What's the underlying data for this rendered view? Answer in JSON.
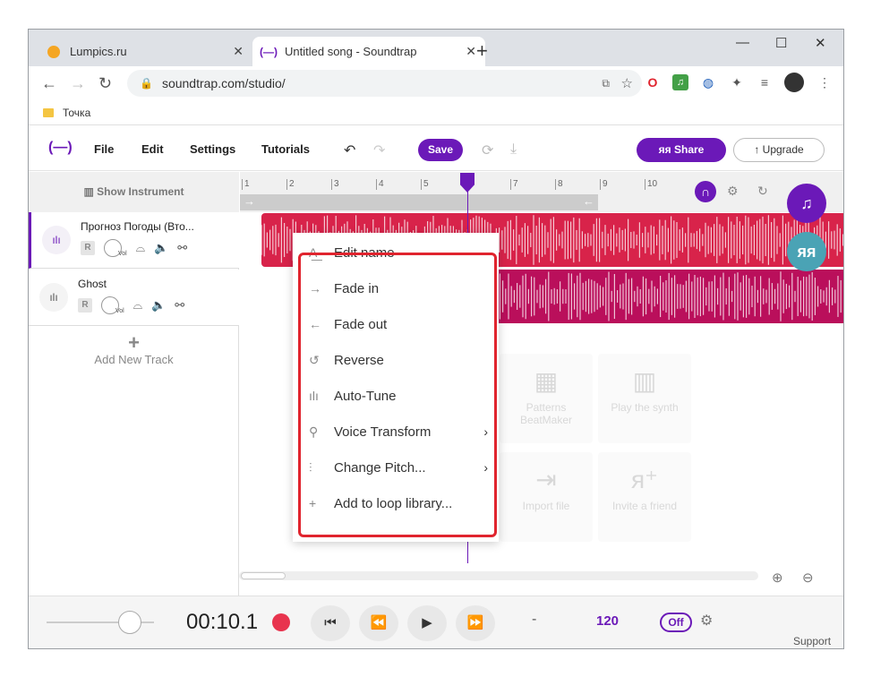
{
  "browser": {
    "tab1_title": "Lumpics.ru",
    "tab2_title": "Untitled song - Soundtrap",
    "url": "soundtrap.com/studio/",
    "bookmark": "Точка"
  },
  "app": {
    "menu": [
      "File",
      "Edit",
      "Settings",
      "Tutorials"
    ],
    "save_label": "Save",
    "share_label": "Share",
    "upgrade_label": "Upgrade"
  },
  "tracks": {
    "show_instrument": "Show Instrument",
    "items": [
      {
        "name": "Прогноз Погоды (Вто..."
      },
      {
        "name": "Ghost"
      }
    ],
    "r_label": "R",
    "vol_label": "Vol",
    "add_label": "Add New Track"
  },
  "ruler": [
    "1",
    "2",
    "3",
    "4",
    "5",
    "6",
    "7",
    "8",
    "9",
    "10"
  ],
  "ghost_tiles": [
    {
      "label": "Patterns BeatMaker"
    },
    {
      "label": "Play the synth"
    },
    {
      "label": "Import file"
    },
    {
      "label": "Invite a friend"
    }
  ],
  "context_menu": [
    {
      "label": "Edit name",
      "icon": "text-icon",
      "glyph": "A͟",
      "has_arrow": false
    },
    {
      "label": "Fade in",
      "icon": "arrow-right-icon",
      "glyph": "→",
      "has_arrow": false
    },
    {
      "label": "Fade out",
      "icon": "arrow-left-icon",
      "glyph": "←",
      "has_arrow": false
    },
    {
      "label": "Reverse",
      "icon": "reverse-icon",
      "glyph": "↺",
      "has_arrow": false
    },
    {
      "label": "Auto-Tune",
      "icon": "autotune-icon",
      "glyph": "ılı",
      "has_arrow": false
    },
    {
      "label": "Voice Transform",
      "icon": "voice-transform-icon",
      "glyph": "⚲",
      "has_arrow": true
    },
    {
      "label": "Change Pitch...",
      "icon": "pitch-icon",
      "glyph": "⫶",
      "has_arrow": true
    },
    {
      "label": "Add to loop library...",
      "icon": "plus-icon",
      "glyph": "+",
      "has_arrow": false
    }
  ],
  "transport": {
    "time": "00:10.1",
    "dash": "-",
    "bpm": "120",
    "metronome": "Off",
    "support": "Support"
  },
  "colors": {
    "accent": "#6b19b8",
    "clip1": "#d8234a",
    "clip2": "#ba0f5b",
    "highlight": "#e0242e"
  }
}
